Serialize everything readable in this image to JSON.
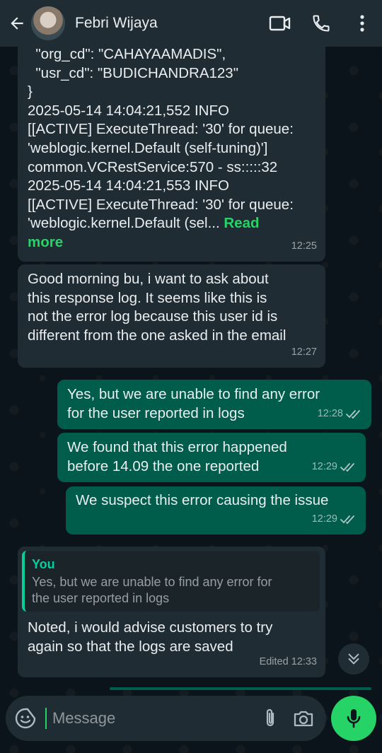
{
  "header": {
    "contact_name": "Febri Wijaya",
    "icons": [
      "back-arrow-icon",
      "video-call-icon",
      "voice-call-icon",
      "more-options-icon"
    ]
  },
  "messages": [
    {
      "direction": "incoming",
      "text": "  \"org_cd\": \"CAHAYAAMADIS\",\n  \"usr_cd\": \"BUDICHANDRA123\"\n}\n2025-05-14 14:04:21,552 INFO\n[[ACTIVE] ExecuteThread: '30' for queue:\n'weblogic.kernel.Default (self-tuning)']\ncommon.VCRestService:570 - ss:::::32\n2025-05-14 14:04:21,553 INFO\n[[ACTIVE] ExecuteThread: '30' for queue:\n'weblogic.kernel.Default (sel... ",
      "read_more": "Read\nmore",
      "time": "12:25"
    },
    {
      "direction": "incoming",
      "text": "Good morning bu, i want to ask about\nthis response log. It seems like this is\nnot the error log because this user id is\ndifferent from the one asked in the email",
      "time": "12:27"
    },
    {
      "direction": "outgoing",
      "text": "Yes, but we are unable to find any error\nfor the user reported in logs",
      "time": "12:28",
      "status": "read"
    },
    {
      "direction": "outgoing",
      "text": "We found that this error happened\nbefore 14.09 the one reported",
      "time": "12:29",
      "status": "read"
    },
    {
      "direction": "outgoing",
      "text": "We suspect this error causing the issue",
      "time": "12:29",
      "status": "read"
    },
    {
      "direction": "incoming",
      "quote": {
        "author": "You",
        "text": "Yes, but we are unable to find any error for\nthe user reported in logs"
      },
      "text": "Noted, i would advise customers to try\nagain so that the logs are saved",
      "time": "Edited 12:33"
    }
  ],
  "composer": {
    "placeholder": "Message"
  },
  "colors": {
    "background": "#0b141a",
    "header": "#1f2c33",
    "incoming_bubble": "#202c33",
    "outgoing_bubble": "#005c4b",
    "accent": "#25d366",
    "read_ticks": "#e9edef"
  }
}
